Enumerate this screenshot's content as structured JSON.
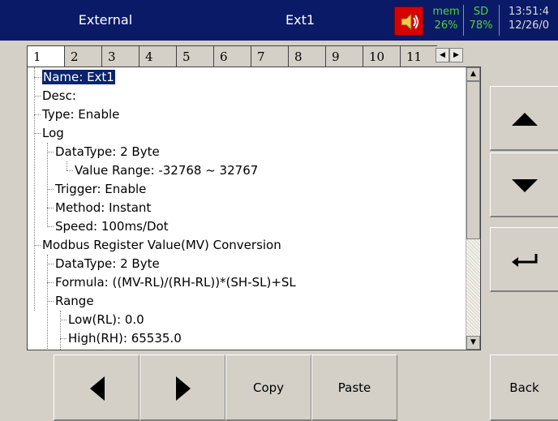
{
  "header": {
    "left_title": "External",
    "center_title": "Ext1",
    "speaker_icon": "speaker-icon",
    "mem_label": "mem",
    "mem_value": "26%",
    "sd_label": "SD",
    "sd_value": "78%",
    "time": "13:51:4",
    "date": "12/26/0"
  },
  "tabs": {
    "items": [
      "1",
      "2",
      "3",
      "4",
      "5",
      "6",
      "7",
      "8",
      "9",
      "10",
      "11"
    ],
    "active": "1"
  },
  "tree": {
    "rows": [
      "Name: Ext1",
      "Desc:",
      "Type: Enable",
      "Log",
      "DataType: 2 Byte",
      "Value Range: -32768 ~ 32767",
      "Trigger: Enable",
      "Method: Instant",
      "Speed: 100ms/Dot",
      "Modbus Register Value(MV) Conversion",
      "DataType: 2 Byte",
      "Formula: ((MV-RL)/(RH-RL))*(SH-SL)+SL",
      "Range",
      "Low(RL): 0.0",
      "High(RH): 65535.0"
    ]
  },
  "side_buttons": {
    "up_icon": "arrow-up-icon",
    "down_icon": "arrow-down-icon",
    "enter_icon": "enter-icon"
  },
  "bottom": {
    "copy_label": "Copy",
    "paste_label": "Paste",
    "back_label": "Back"
  }
}
